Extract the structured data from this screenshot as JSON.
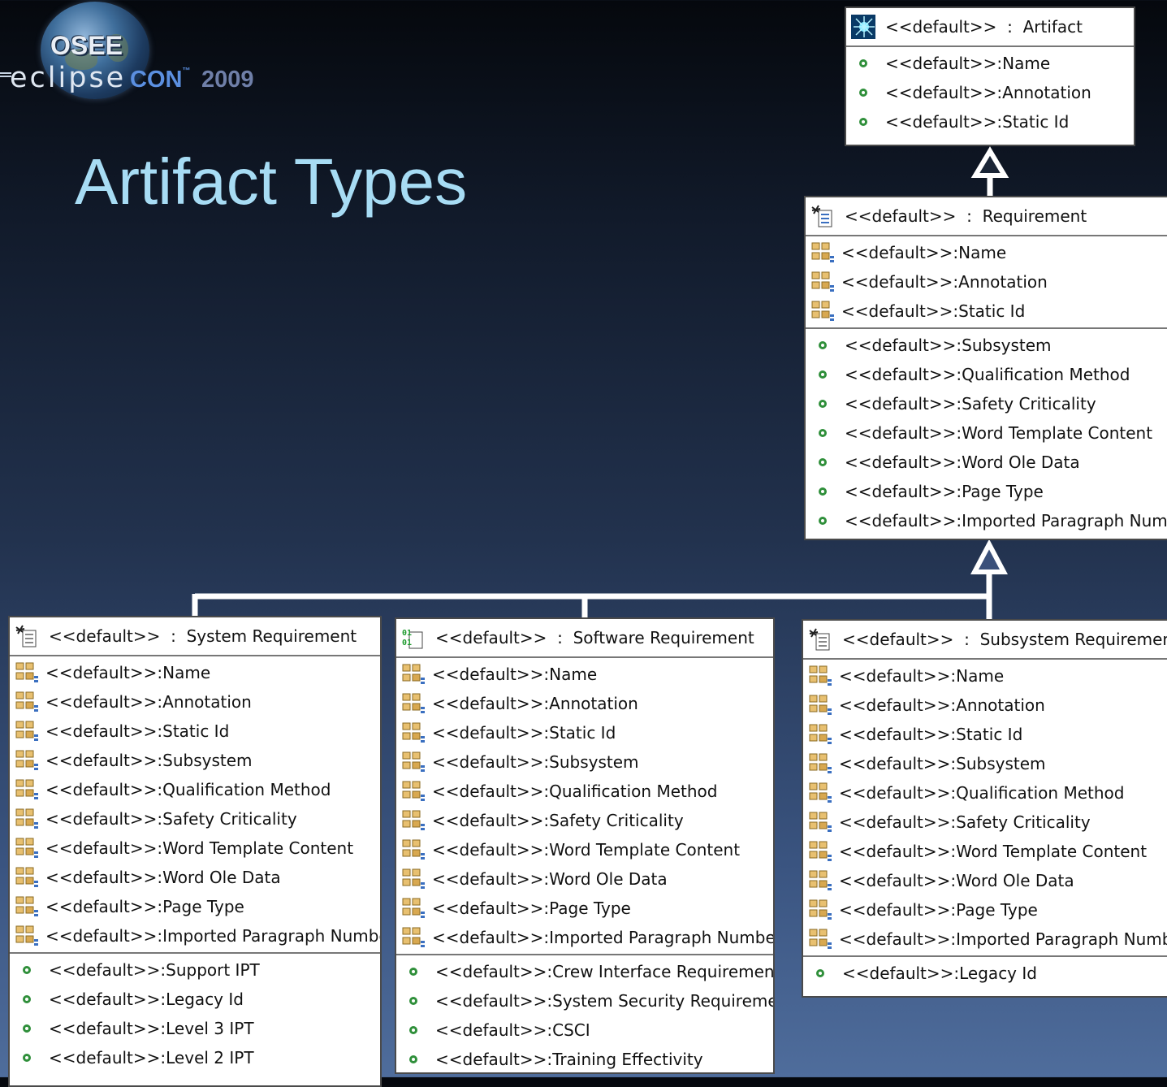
{
  "logo": {
    "osee": "OSEE",
    "eclipse": "eclipse",
    "con": "CON",
    "tm": "™",
    "year": "2009"
  },
  "title": "Artifact Types",
  "artifact": {
    "header": "<<default>>  :  Artifact",
    "rows": [
      "<<default>>:Name",
      "<<default>>:Annotation",
      "<<default>>:Static Id"
    ]
  },
  "requirement": {
    "header": "<<default>>  :  Requirement",
    "inherited": [
      "<<default>>:Name",
      "<<default>>:Annotation",
      "<<default>>:Static Id"
    ],
    "own": [
      "<<default>>:Subsystem",
      "<<default>>:Qualification Method",
      "<<default>>:Safety Criticality",
      "<<default>>:Word Template Content",
      "<<default>>:Word Ole Data",
      "<<default>>:Page Type",
      "<<default>>:Imported Paragraph Number"
    ]
  },
  "system_requirement": {
    "header": "<<default>>  :  System Requirement",
    "inherited": [
      "<<default>>:Name",
      "<<default>>:Annotation",
      "<<default>>:Static Id",
      "<<default>>:Subsystem",
      "<<default>>:Qualification Method",
      "<<default>>:Safety Criticality",
      "<<default>>:Word Template Content",
      "<<default>>:Word Ole Data",
      "<<default>>:Page Type",
      "<<default>>:Imported Paragraph Number"
    ],
    "own": [
      "<<default>>:Support IPT",
      "<<default>>:Legacy Id",
      "<<default>>:Level 3 IPT",
      "<<default>>:Level 2 IPT"
    ]
  },
  "software_requirement": {
    "header": "<<default>>  :  Software Requirement",
    "inherited": [
      "<<default>>:Name",
      "<<default>>:Annotation",
      "<<default>>:Static Id",
      "<<default>>:Subsystem",
      "<<default>>:Qualification Method",
      "<<default>>:Safety Criticality",
      "<<default>>:Word Template Content",
      "<<default>>:Word Ole Data",
      "<<default>>:Page Type",
      "<<default>>:Imported Paragraph Number"
    ],
    "own": [
      "<<default>>:Crew Interface Requirement",
      "<<default>>:System Security Requirement",
      "<<default>>:CSCI",
      "<<default>>:Training Effectivity"
    ]
  },
  "subsystem_requirement": {
    "header": "<<default>>  :  Subsystem Requirement",
    "inherited": [
      "<<default>>:Name",
      "<<default>>:Annotation",
      "<<default>>:Static Id",
      "<<default>>:Subsystem",
      "<<default>>:Qualification Method",
      "<<default>>:Safety Criticality",
      "<<default>>:Word Template Content",
      "<<default>>:Word Ole Data",
      "<<default>>:Page Type",
      "<<default>>:Imported Paragraph Number"
    ],
    "own": [
      "<<default>>:Legacy Id"
    ]
  },
  "icons": {
    "artifact_header": "starburst-icon",
    "requirement_header": "requirement-document-icon",
    "software_header": "binary-document-icon",
    "inherited_attribute": "inherited-attribute-icon",
    "own_attribute": "attribute-circle-icon"
  },
  "colors": {
    "title": "#a7dcf4",
    "attribute_dot": "#2f8f3a",
    "connector": "#ffffff"
  }
}
